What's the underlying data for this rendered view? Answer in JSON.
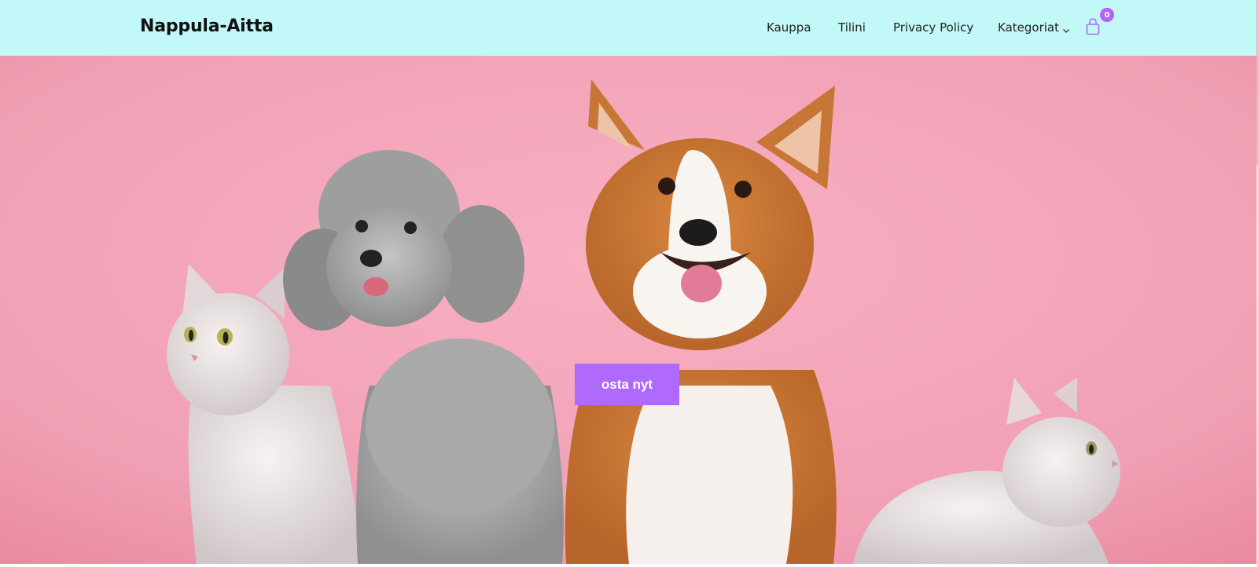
{
  "site": {
    "logo": "Nappula-Aitta"
  },
  "nav": {
    "items": [
      {
        "label": "Kauppa"
      },
      {
        "label": "Tilini"
      },
      {
        "label": "Privacy Policy"
      },
      {
        "label": "Kategoriat"
      }
    ],
    "cart_count": "0",
    "dropdown_icon": "chevron-down-icon",
    "cart_icon": "shopping-bag-icon"
  },
  "hero": {
    "cta_label": "osta nyt",
    "image_description_icon": "pets-photo"
  },
  "colors": {
    "header_bg": "#c2f8f8",
    "accent": "#b069fd",
    "hero_bg": "#f5a6bb"
  }
}
